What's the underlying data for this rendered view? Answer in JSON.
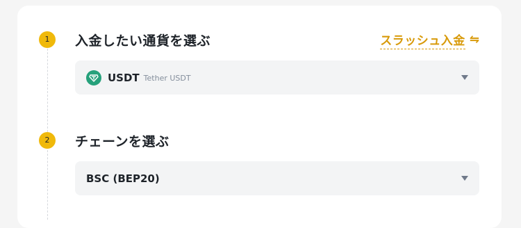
{
  "step1": {
    "number": "1",
    "title": "入金したい通貨を選ぶ",
    "link_label": "スラッシュ入金",
    "link_icon": "swap-arrows-icon",
    "select": {
      "coin_icon": "tether-icon",
      "coin_symbol": "USDT",
      "coin_name": "Tether USDT",
      "caret_icon": "caret-down-icon"
    }
  },
  "step2": {
    "number": "2",
    "title": "チェーンを選ぶ",
    "select": {
      "value": "BSC (BEP20)",
      "caret_icon": "caret-down-icon"
    }
  },
  "colors": {
    "accent": "#F0B90B",
    "link": "#D89A0A",
    "tether": "#26A17B",
    "select_bg": "#F3F4F5",
    "card_bg": "#FFFFFF",
    "page_bg": "#F5F5F5"
  }
}
